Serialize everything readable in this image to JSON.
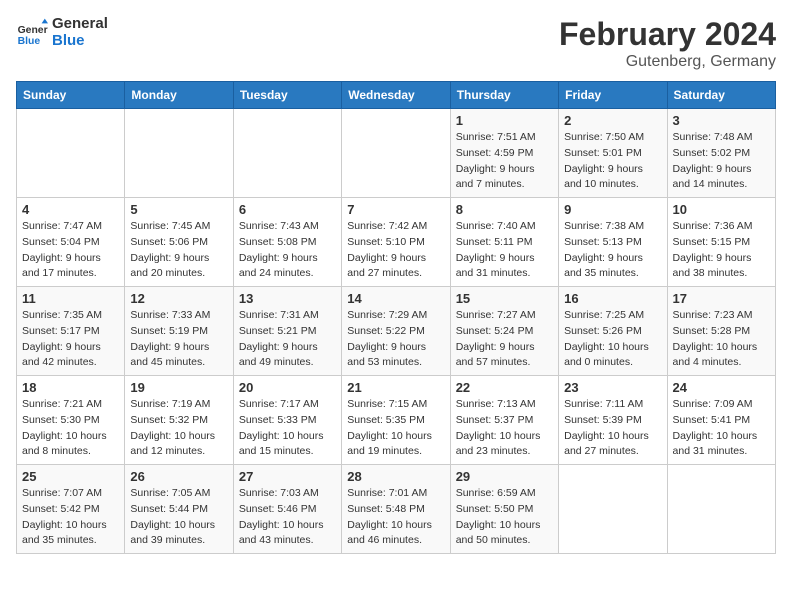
{
  "logo": {
    "text_general": "General",
    "text_blue": "Blue"
  },
  "header": {
    "title": "February 2024",
    "subtitle": "Gutenberg, Germany"
  },
  "weekdays": [
    "Sunday",
    "Monday",
    "Tuesday",
    "Wednesday",
    "Thursday",
    "Friday",
    "Saturday"
  ],
  "weeks": [
    [
      {
        "day": "",
        "info": ""
      },
      {
        "day": "",
        "info": ""
      },
      {
        "day": "",
        "info": ""
      },
      {
        "day": "",
        "info": ""
      },
      {
        "day": "1",
        "info": "Sunrise: 7:51 AM\nSunset: 4:59 PM\nDaylight: 9 hours\nand 7 minutes."
      },
      {
        "day": "2",
        "info": "Sunrise: 7:50 AM\nSunset: 5:01 PM\nDaylight: 9 hours\nand 10 minutes."
      },
      {
        "day": "3",
        "info": "Sunrise: 7:48 AM\nSunset: 5:02 PM\nDaylight: 9 hours\nand 14 minutes."
      }
    ],
    [
      {
        "day": "4",
        "info": "Sunrise: 7:47 AM\nSunset: 5:04 PM\nDaylight: 9 hours\nand 17 minutes."
      },
      {
        "day": "5",
        "info": "Sunrise: 7:45 AM\nSunset: 5:06 PM\nDaylight: 9 hours\nand 20 minutes."
      },
      {
        "day": "6",
        "info": "Sunrise: 7:43 AM\nSunset: 5:08 PM\nDaylight: 9 hours\nand 24 minutes."
      },
      {
        "day": "7",
        "info": "Sunrise: 7:42 AM\nSunset: 5:10 PM\nDaylight: 9 hours\nand 27 minutes."
      },
      {
        "day": "8",
        "info": "Sunrise: 7:40 AM\nSunset: 5:11 PM\nDaylight: 9 hours\nand 31 minutes."
      },
      {
        "day": "9",
        "info": "Sunrise: 7:38 AM\nSunset: 5:13 PM\nDaylight: 9 hours\nand 35 minutes."
      },
      {
        "day": "10",
        "info": "Sunrise: 7:36 AM\nSunset: 5:15 PM\nDaylight: 9 hours\nand 38 minutes."
      }
    ],
    [
      {
        "day": "11",
        "info": "Sunrise: 7:35 AM\nSunset: 5:17 PM\nDaylight: 9 hours\nand 42 minutes."
      },
      {
        "day": "12",
        "info": "Sunrise: 7:33 AM\nSunset: 5:19 PM\nDaylight: 9 hours\nand 45 minutes."
      },
      {
        "day": "13",
        "info": "Sunrise: 7:31 AM\nSunset: 5:21 PM\nDaylight: 9 hours\nand 49 minutes."
      },
      {
        "day": "14",
        "info": "Sunrise: 7:29 AM\nSunset: 5:22 PM\nDaylight: 9 hours\nand 53 minutes."
      },
      {
        "day": "15",
        "info": "Sunrise: 7:27 AM\nSunset: 5:24 PM\nDaylight: 9 hours\nand 57 minutes."
      },
      {
        "day": "16",
        "info": "Sunrise: 7:25 AM\nSunset: 5:26 PM\nDaylight: 10 hours\nand 0 minutes."
      },
      {
        "day": "17",
        "info": "Sunrise: 7:23 AM\nSunset: 5:28 PM\nDaylight: 10 hours\nand 4 minutes."
      }
    ],
    [
      {
        "day": "18",
        "info": "Sunrise: 7:21 AM\nSunset: 5:30 PM\nDaylight: 10 hours\nand 8 minutes."
      },
      {
        "day": "19",
        "info": "Sunrise: 7:19 AM\nSunset: 5:32 PM\nDaylight: 10 hours\nand 12 minutes."
      },
      {
        "day": "20",
        "info": "Sunrise: 7:17 AM\nSunset: 5:33 PM\nDaylight: 10 hours\nand 15 minutes."
      },
      {
        "day": "21",
        "info": "Sunrise: 7:15 AM\nSunset: 5:35 PM\nDaylight: 10 hours\nand 19 minutes."
      },
      {
        "day": "22",
        "info": "Sunrise: 7:13 AM\nSunset: 5:37 PM\nDaylight: 10 hours\nand 23 minutes."
      },
      {
        "day": "23",
        "info": "Sunrise: 7:11 AM\nSunset: 5:39 PM\nDaylight: 10 hours\nand 27 minutes."
      },
      {
        "day": "24",
        "info": "Sunrise: 7:09 AM\nSunset: 5:41 PM\nDaylight: 10 hours\nand 31 minutes."
      }
    ],
    [
      {
        "day": "25",
        "info": "Sunrise: 7:07 AM\nSunset: 5:42 PM\nDaylight: 10 hours\nand 35 minutes."
      },
      {
        "day": "26",
        "info": "Sunrise: 7:05 AM\nSunset: 5:44 PM\nDaylight: 10 hours\nand 39 minutes."
      },
      {
        "day": "27",
        "info": "Sunrise: 7:03 AM\nSunset: 5:46 PM\nDaylight: 10 hours\nand 43 minutes."
      },
      {
        "day": "28",
        "info": "Sunrise: 7:01 AM\nSunset: 5:48 PM\nDaylight: 10 hours\nand 46 minutes."
      },
      {
        "day": "29",
        "info": "Sunrise: 6:59 AM\nSunset: 5:50 PM\nDaylight: 10 hours\nand 50 minutes."
      },
      {
        "day": "",
        "info": ""
      },
      {
        "day": "",
        "info": ""
      }
    ]
  ]
}
